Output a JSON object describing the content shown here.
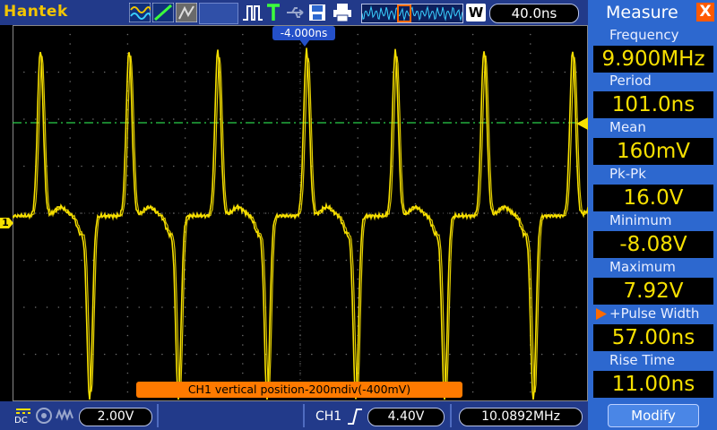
{
  "header": {
    "brand": "Hantek",
    "timebase": "40.0ns",
    "run_state": "W",
    "trigger_position": "-4.000ns"
  },
  "notice": "CH1 vertical position-200mdiv(-400mV)",
  "footer": {
    "ch1_coupling": "DC",
    "ch1_scale": "2.00V",
    "trigger_source": "CH1",
    "trigger_level": "4.40V",
    "frequency_counter": "10.0892MHz"
  },
  "measure": {
    "title": "Measure",
    "close": "X",
    "items": [
      {
        "label": "Frequency",
        "value": "9.900MHz"
      },
      {
        "label": "Period",
        "value": "101.0ns"
      },
      {
        "label": "Mean",
        "value": "160mV"
      },
      {
        "label": "Pk-Pk",
        "value": "16.0V"
      },
      {
        "label": "Minimum",
        "value": "-8.08V"
      },
      {
        "label": "Maximum",
        "value": "7.92V"
      },
      {
        "label": "+Pulse Width",
        "value": "57.00ns"
      },
      {
        "label": "Rise Time",
        "value": "11.00ns"
      }
    ],
    "modify_label": "Modify"
  },
  "channel_marker": "1",
  "colors": {
    "ch1": "#f7e000",
    "accent": "#2d68cf",
    "notice": "#ff7a00",
    "grid": "#7a7a7a"
  }
}
